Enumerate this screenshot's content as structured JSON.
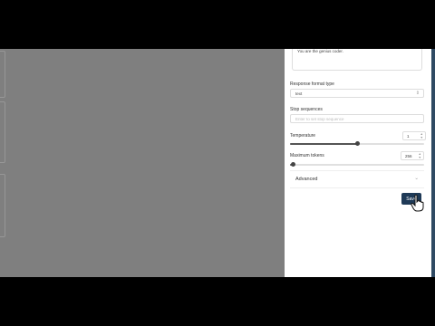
{
  "system_message": {
    "value": "You are the genius coder."
  },
  "response_format": {
    "label": "Response format type",
    "value": "text"
  },
  "stop_sequences": {
    "label": "Stop sequences",
    "placeholder": "Enter to set stop sequence"
  },
  "temperature": {
    "label": "Temperature",
    "value": "1",
    "fraction": 0.5
  },
  "max_tokens": {
    "label": "Maximum tokens",
    "value": "256",
    "fraction": 0.02
  },
  "advanced": {
    "label": "Advanced"
  },
  "save_label": "Save",
  "colors": {
    "overlay": "#7f7f7f",
    "panel": "#ffffff",
    "accent": "#1f3a57"
  }
}
